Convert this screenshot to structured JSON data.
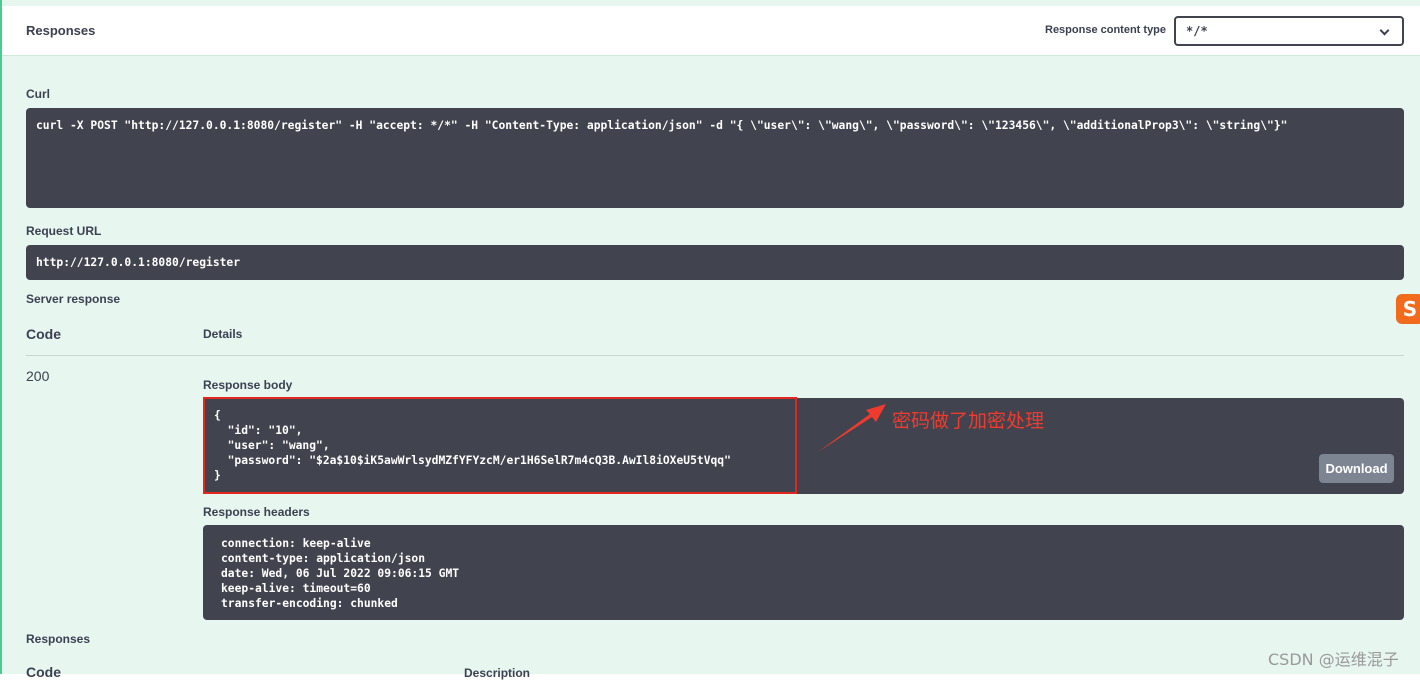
{
  "header": {
    "title": "Responses",
    "content_type_label": "Response content type",
    "content_type_value": "*/*"
  },
  "curl": {
    "label": "Curl",
    "command": "curl -X POST \"http://127.0.0.1:8080/register\" -H \"accept: */*\" -H \"Content-Type: application/json\" -d \"{ \\\"user\\\": \\\"wang\\\", \\\"password\\\": \\\"123456\\\", \\\"additionalProp3\\\": \\\"string\\\"}\""
  },
  "request_url": {
    "label": "Request URL",
    "value": "http://127.0.0.1:8080/register"
  },
  "server_response": {
    "label": "Server response",
    "code_header": "Code",
    "details_header": "Details",
    "code": "200",
    "body_label": "Response body",
    "body": "{\n  \"id\": \"10\",\n  \"user\": \"wang\",\n  \"password\": \"$2a$10$iK5awWrlsydMZfYFYzcM/er1H6SelR7m4cQ3B.AwIl8iOXeU5tVqq\"\n}",
    "download_label": "Download",
    "headers_label": "Response headers",
    "headers": "connection: keep-alive\ncontent-type: application/json\ndate: Wed, 06 Jul 2022 09:06:15 GMT\nkeep-alive: timeout=60\ntransfer-encoding: chunked"
  },
  "responses_footer": {
    "label": "Responses",
    "code_header": "Code",
    "description_header": "Description"
  },
  "annotation": {
    "text": "密码做了加密处理",
    "color": "#f03a2e"
  },
  "watermark": "CSDN @运维混子",
  "side_logo": "S"
}
